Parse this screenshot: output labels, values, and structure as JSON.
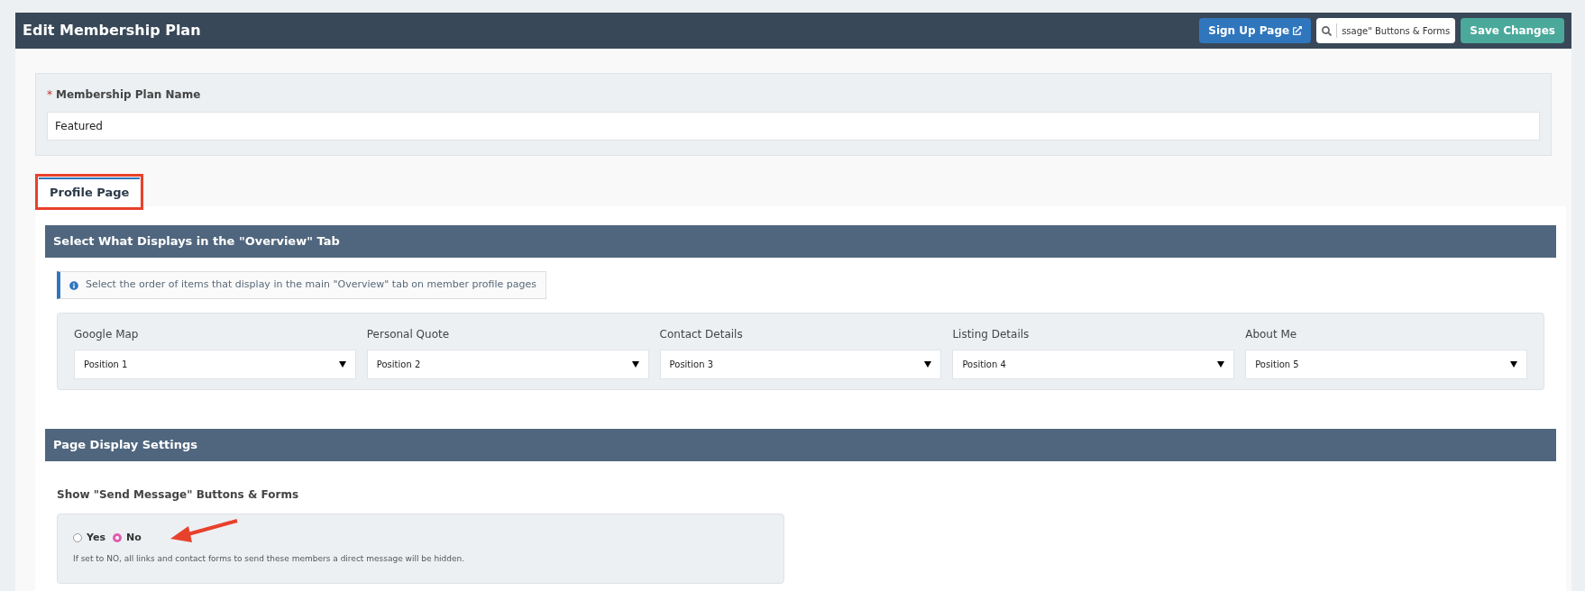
{
  "header": {
    "title": "Edit Membership Plan",
    "signup_button": "Sign Up Page",
    "search": {
      "value": "ssage\" Buttons & Forms"
    },
    "save_button": "Save Changes"
  },
  "plan_name": {
    "required_mark": "*",
    "label": "Membership Plan Name",
    "value": "Featured"
  },
  "tabs": [
    {
      "label": "Profile Page",
      "selected": true
    }
  ],
  "overview": {
    "title": "Select What Displays in the \"Overview\" Tab",
    "info": "Select the order of items that display in the main \"Overview\" tab on member profile pages",
    "fields": [
      {
        "label": "Google Map",
        "value": "Position 1"
      },
      {
        "label": "Personal Quote",
        "value": "Position 2"
      },
      {
        "label": "Contact Details",
        "value": "Position 3"
      },
      {
        "label": "Listing Details",
        "value": "Position 4"
      },
      {
        "label": "About Me",
        "value": "Position 5"
      }
    ]
  },
  "display_settings": {
    "title": "Page Display Settings",
    "setting_label": "Show \"Send Message\" Buttons & Forms",
    "options": [
      {
        "label": "Yes",
        "selected": false
      },
      {
        "label": "No",
        "selected": true
      }
    ],
    "help": "If set to NO, all links and contact forms to send these members a direct message will be hidden."
  }
}
